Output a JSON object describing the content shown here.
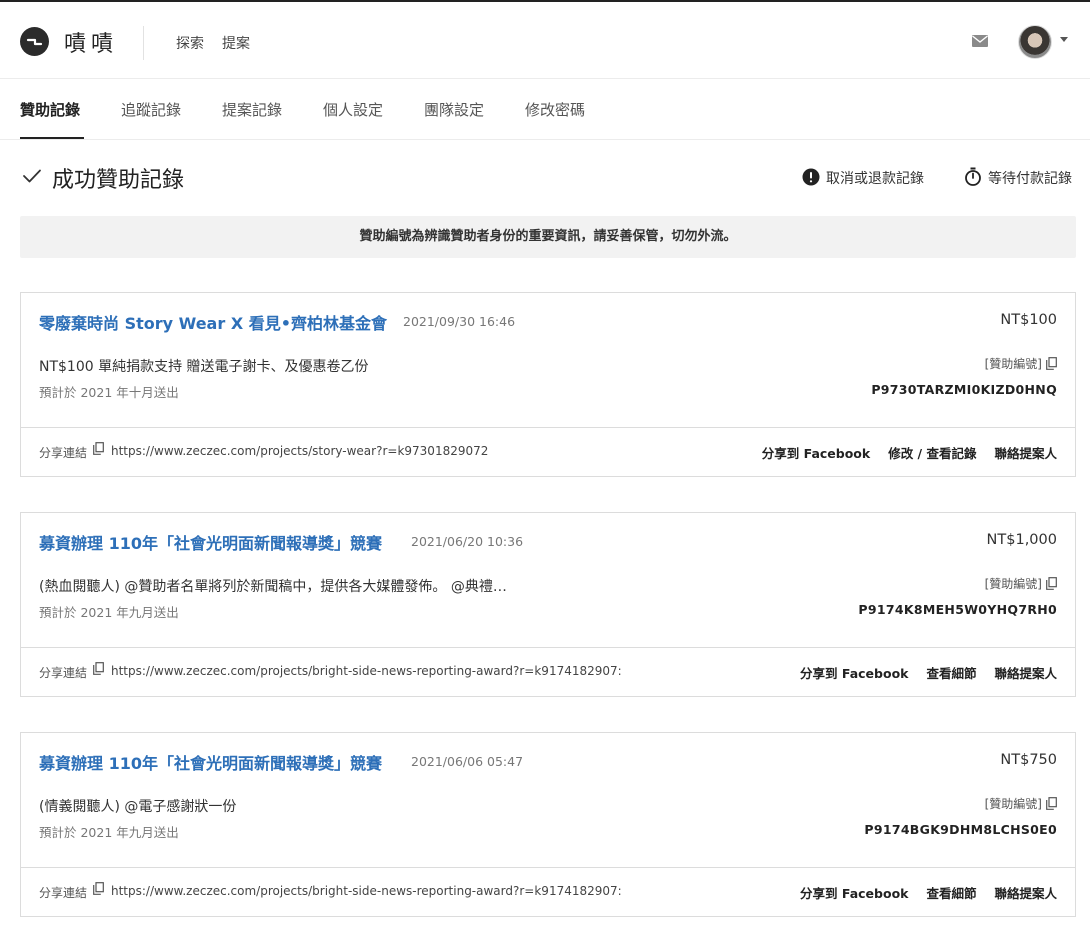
{
  "header": {
    "logo_text": "嘖嘖",
    "nav": [
      "探索",
      "提案"
    ]
  },
  "tabs": [
    {
      "label": "贊助記錄",
      "active": true
    },
    {
      "label": "追蹤記錄",
      "active": false
    },
    {
      "label": "提案記錄",
      "active": false
    },
    {
      "label": "個人設定",
      "active": false
    },
    {
      "label": "團隊設定",
      "active": false
    },
    {
      "label": "修改密碼",
      "active": false
    }
  ],
  "section": {
    "title": "成功贊助記錄",
    "cancel_link": "取消或退款記錄",
    "pending_link": "等待付款記錄"
  },
  "notice": "贊助編號為辨識贊助者身份的重要資訊，請妥善保管，切勿外流。",
  "share_label": "分享連結",
  "sponsor_label": "[贊助編號]",
  "records": [
    {
      "title": "零廢棄時尚 Story Wear X 看見•齊柏林基金會",
      "date": "2021/09/30 16:46",
      "amount": "NT$100",
      "reward": "NT$100 單純捐款支持 贈送電子謝卡、及優惠卷乙份",
      "ship": "預計於 2021 年十月送出",
      "code": "P9730TARZMI0KIZD0HNQ",
      "url": "https://www.zeczec.com/projects/story-wear?r=k97301829072",
      "actions": [
        "分享到 Facebook",
        "修改 / 查看記錄",
        "聯絡提案人"
      ]
    },
    {
      "title": "募資辦理 110年「社會光明面新聞報導獎」競賽",
      "date": "2021/06/20 10:36",
      "amount": "NT$1,000",
      "reward": "(熱血閱聽人) @贊助者名單將列於新聞稿中，提供各大媒體發佈。 @典禮…",
      "ship": "預計於 2021 年九月送出",
      "code": "P9174K8MEH5W0YHQ7RH0",
      "url": "https://www.zeczec.com/projects/bright-side-news-reporting-award?r=k9174182907:",
      "actions": [
        "分享到 Facebook",
        "查看細節",
        "聯絡提案人"
      ]
    },
    {
      "title": "募資辦理 110年「社會光明面新聞報導獎」競賽",
      "date": "2021/06/06 05:47",
      "amount": "NT$750",
      "reward": "(情義閱聽人) @電子感謝狀一份",
      "ship": "預計於 2021 年九月送出",
      "code": "P9174BGK9DHM8LCHS0E0",
      "url": "https://www.zeczec.com/projects/bright-side-news-reporting-award?r=k9174182907:",
      "actions": [
        "分享到 Facebook",
        "查看細節",
        "聯絡提案人"
      ]
    }
  ],
  "colors": {
    "link_blue": "#2d6fb8",
    "notice_bg": "#f2f2f2",
    "border": "#dcdcdc"
  }
}
